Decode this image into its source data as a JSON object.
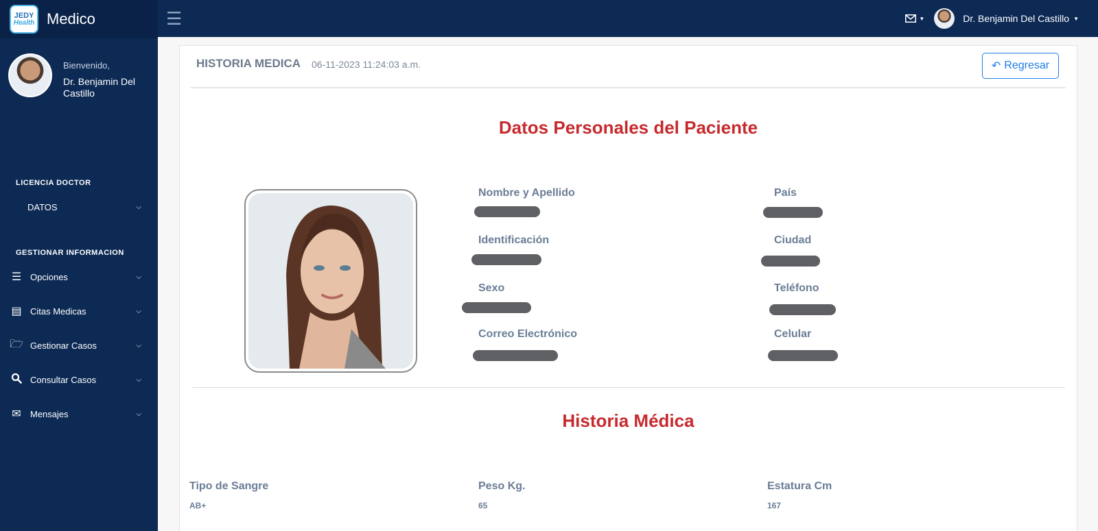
{
  "brand": {
    "logo_top": "JEDY",
    "logo_bottom": "Health",
    "app_name": "Medico"
  },
  "profile": {
    "welcome": "Bienvenido,",
    "name": "Dr. Benjamin Del Castillo"
  },
  "sidebar": {
    "section1": "LICENCIA DOCTOR",
    "datos": "DATOS",
    "section2": "GESTIONAR INFORMACION",
    "items": [
      {
        "label": "Opciones",
        "icon": "menu-icon"
      },
      {
        "label": "Citas Medicas",
        "icon": "newspaper-icon"
      },
      {
        "label": "Gestionar Casos",
        "icon": "folder-open-icon"
      },
      {
        "label": "Consultar Casos",
        "icon": "search-icon"
      },
      {
        "label": "Mensajes",
        "icon": "envelope-icon"
      }
    ]
  },
  "topbar": {
    "user_name": "Dr. Benjamin Del Castillo"
  },
  "header": {
    "title": "HISTORIA MEDICA",
    "date": "06-11-2023 11:24:03 a.m.",
    "back_label": "Regresar"
  },
  "personal": {
    "heading": "Datos Personales del Paciente",
    "fields": {
      "nombre": "Nombre y Apellido",
      "identificacion": "Identificación",
      "sexo": "Sexo",
      "correo": "Correo Electrónico",
      "pais": "País",
      "ciudad": "Ciudad",
      "telefono": "Teléfono",
      "celular": "Celular"
    }
  },
  "medical": {
    "heading": "Historia Médica",
    "tipo_sangre_label": "Tipo de Sangre",
    "tipo_sangre": "AB+",
    "peso_label": "Peso Kg.",
    "peso": "65",
    "estatura_label": "Estatura Cm",
    "estatura": "167"
  },
  "colors": {
    "sidebar": "#0d2a55",
    "accent_red": "#c62a2e",
    "link_blue": "#1e7be6"
  }
}
